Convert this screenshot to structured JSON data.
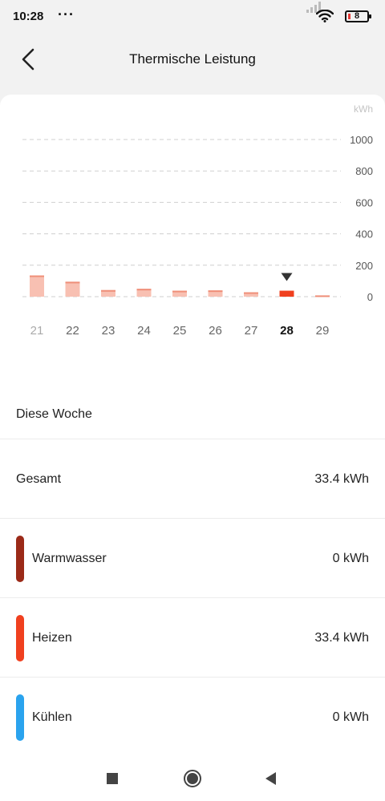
{
  "status_bar": {
    "time": "10:28",
    "dots": "···",
    "battery_level": "8",
    "icons": [
      "signal-icon",
      "wifi-icon",
      "battery-icon"
    ]
  },
  "header": {
    "title": "Thermische Leistung",
    "back_icon": "chevron-left-icon"
  },
  "chart_data": {
    "type": "bar",
    "unit_label": "kWh",
    "categories": [
      "21",
      "22",
      "23",
      "24",
      "25",
      "26",
      "27",
      "28",
      "29"
    ],
    "values": [
      135,
      95,
      42,
      50,
      38,
      40,
      28,
      38,
      8
    ],
    "selected_index": 7,
    "yticks": [
      1000,
      800,
      600,
      400,
      200,
      0
    ],
    "ylim": [
      0,
      1000
    ],
    "grid": true,
    "colors": {
      "bar": "#f8c0b2",
      "bar_top": "#ef8f79",
      "selected": "#f0401f",
      "grid": "#cfcfcf",
      "marker": "#333333"
    }
  },
  "summary": {
    "section_title": "Diese Woche",
    "total": {
      "label": "Gesamt",
      "value": "33.4 kWh"
    },
    "items": [
      {
        "label": "Warmwasser",
        "value": "0 kWh",
        "color": "#9b2a18"
      },
      {
        "label": "Heizen",
        "value": "33.4 kWh",
        "color": "#f0401f"
      },
      {
        "label": "Kühlen",
        "value": "0 kWh",
        "color": "#2aa3ee"
      }
    ]
  },
  "nav_bar": {
    "buttons": [
      "recent-apps-icon",
      "home-icon",
      "back-triangle-icon"
    ]
  }
}
